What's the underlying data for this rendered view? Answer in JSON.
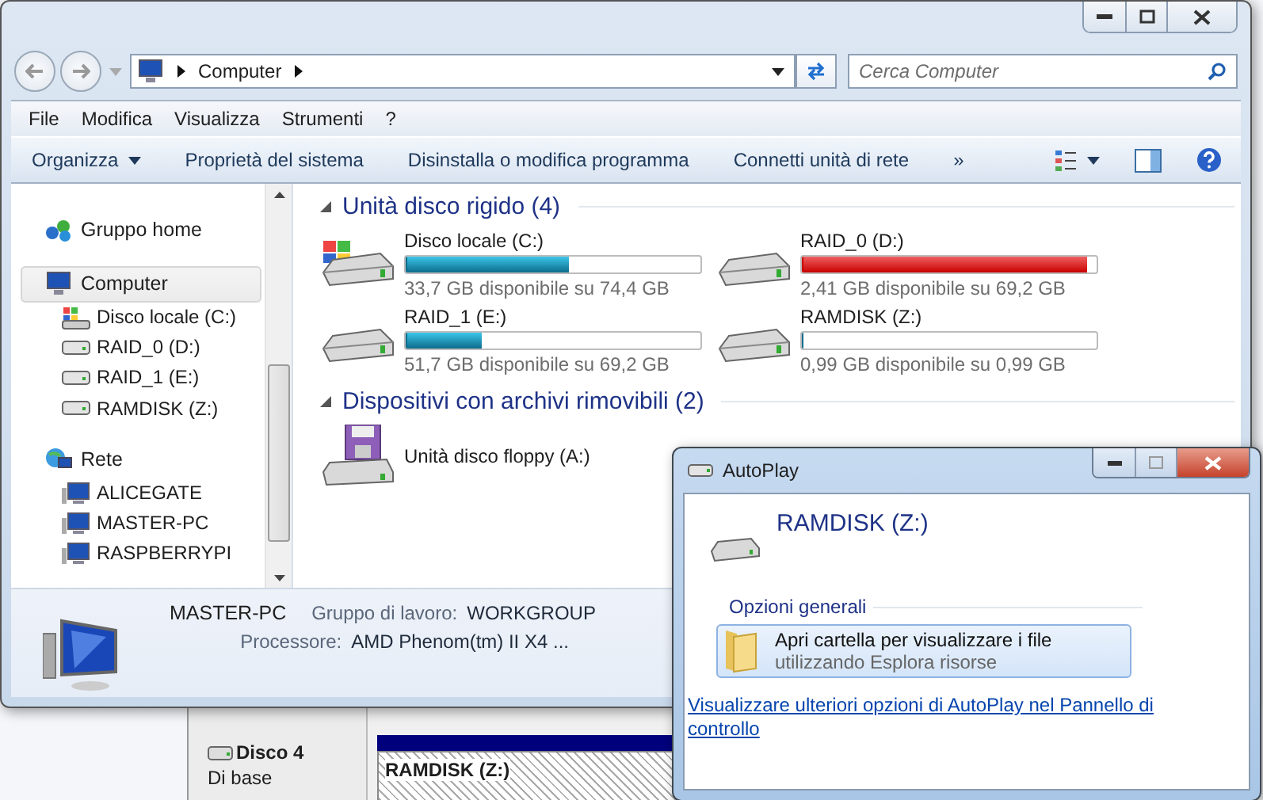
{
  "explorer": {
    "address": {
      "location": "Computer"
    },
    "search": {
      "placeholder": "Cerca Computer"
    },
    "menu": [
      "File",
      "Modifica",
      "Visualizza",
      "Strumenti",
      "?"
    ],
    "toolbar": [
      {
        "label": "Organizza",
        "kind": "dropdown"
      },
      {
        "label": "Proprietà del sistema",
        "kind": "plain"
      },
      {
        "label": "Disinstalla o modifica programma",
        "kind": "plain"
      },
      {
        "label": "Connetti unità di rete",
        "kind": "plain"
      },
      {
        "label": "»",
        "kind": "plain"
      }
    ],
    "sidebar": {
      "items": [
        {
          "label": "Gruppo home",
          "kind": "homegroup",
          "selected": false
        },
        {
          "label": "Computer",
          "kind": "computer",
          "selected": true,
          "children": [
            {
              "label": "Disco locale (C:)",
              "kind": "system",
              "selected": false
            },
            {
              "label": "RAID_0 (D:)",
              "kind": "drive",
              "selected": false
            },
            {
              "label": "RAID_1 (E:)",
              "kind": "drive",
              "selected": false
            },
            {
              "label": "RAMDISK (Z:)",
              "kind": "drive",
              "selected": false
            }
          ]
        },
        {
          "label": "Rete",
          "kind": "network",
          "selected": false,
          "children": [
            {
              "label": "ALICEGATE",
              "kind": "pc",
              "selected": false
            },
            {
              "label": "MASTER-PC",
              "kind": "pc",
              "selected": false
            },
            {
              "label": "RASPBERRYPI",
              "kind": "pc",
              "selected": false
            }
          ]
        }
      ]
    },
    "sections": [
      {
        "title": "Unità disco rigido (4)",
        "expanded": true,
        "items": [
          {
            "name": "Disco locale (C:)",
            "kind": "system",
            "level": 0.547,
            "low_space": false,
            "reading": "33,7 GB disponibile su 74,4 GB"
          },
          {
            "name": "RAID_0 (D:)",
            "kind": "drive",
            "level": 0.965,
            "low_space": true,
            "reading": "2,41 GB disponibile su 69,2 GB"
          },
          {
            "name": "RAID_1 (E:)",
            "kind": "drive",
            "level": 0.253,
            "low_space": false,
            "reading": "51,7 GB disponibile su 69,2 GB"
          },
          {
            "name": "RAMDISK (Z:)",
            "kind": "drive",
            "level": 0,
            "low_space": false,
            "reading": "0,99 GB disponibile su 0,99 GB"
          }
        ]
      },
      {
        "title": "Dispositivi con archivi rimovibili (2)",
        "expanded": true,
        "items": [
          {
            "name": "Unità disco floppy (A:)",
            "kind": "floppy"
          }
        ]
      }
    ],
    "details": {
      "name": "MASTER-PC",
      "fields": [
        {
          "label": "Gruppo di lavoro:",
          "value": "WORKGROUP"
        },
        {
          "label": "Processore:",
          "value": "AMD Phenom(tm) II X4 ..."
        }
      ]
    }
  },
  "autoplay": {
    "title": "AutoPlay",
    "device": "RAMDISK (Z:)",
    "group": "Opzioni generali",
    "options": [
      {
        "title": "Apri cartella per visualizzare i file",
        "subtitle": "utilizzando Esplora risorse"
      }
    ],
    "link": "Visualizzare ulteriori opzioni di AutoPlay nel Pannello di controllo"
  },
  "background": {
    "disk": "Disco 4",
    "type": "Di base",
    "partition": "RAMDISK  (Z:)"
  }
}
